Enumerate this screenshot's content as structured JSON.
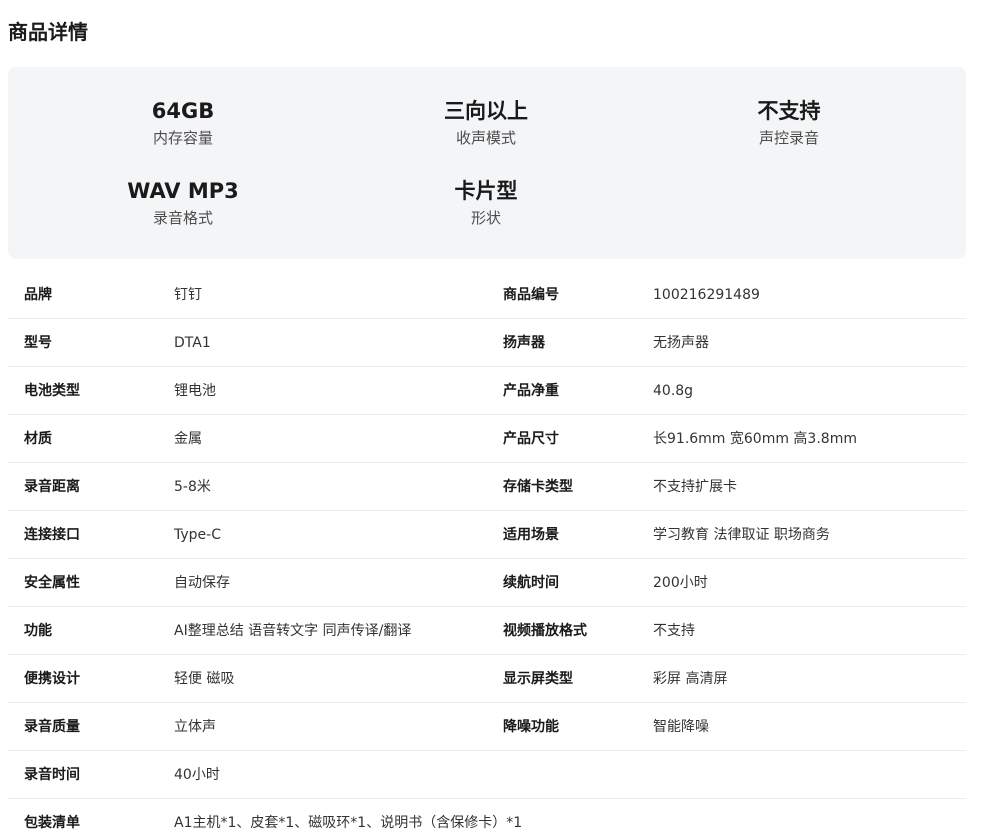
{
  "section": {
    "title": "商品详情"
  },
  "highlights": [
    {
      "value": "64GB",
      "label": "内存容量"
    },
    {
      "value": "三向以上",
      "label": "收声模式"
    },
    {
      "value": "不支持",
      "label": "声控录音"
    },
    {
      "value": "WAV MP3",
      "label": "录音格式"
    },
    {
      "value": "卡片型",
      "label": "形状"
    }
  ],
  "specs": [
    {
      "k1": "品牌",
      "v1": "钉钉",
      "k2": "商品编号",
      "v2": "100216291489"
    },
    {
      "k1": "型号",
      "v1": "DTA1",
      "k2": "扬声器",
      "v2": "无扬声器"
    },
    {
      "k1": "电池类型",
      "v1": "锂电池",
      "k2": "产品净重",
      "v2": "40.8g"
    },
    {
      "k1": "材质",
      "v1": "金属",
      "k2": "产品尺寸",
      "v2": "长91.6mm 宽60mm 高3.8mm"
    },
    {
      "k1": "录音距离",
      "v1": "5-8米",
      "k2": "存储卡类型",
      "v2": "不支持扩展卡"
    },
    {
      "k1": "连接接口",
      "v1": "Type-C",
      "k2": "适用场景",
      "v2": "学习教育 法律取证 职场商务"
    },
    {
      "k1": "安全属性",
      "v1": "自动保存",
      "k2": "续航时间",
      "v2": "200小时"
    },
    {
      "k1": "功能",
      "v1": "AI整理总结 语音转文字 同声传译/翻译",
      "k2": "视频播放格式",
      "v2": "不支持"
    },
    {
      "k1": "便携设计",
      "v1": "轻便 磁吸",
      "k2": "显示屏类型",
      "v2": "彩屏 高清屏"
    },
    {
      "k1": "录音质量",
      "v1": "立体声",
      "k2": "降噪功能",
      "v2": "智能降噪"
    },
    {
      "k1": "录音时间",
      "v1": "40小时",
      "k2": "",
      "v2": ""
    },
    {
      "k1": "包装清单",
      "v1": "A1主机*1、皮套*1、磁吸环*1、说明书（含保修卡）*1",
      "k2": "",
      "v2": ""
    }
  ]
}
